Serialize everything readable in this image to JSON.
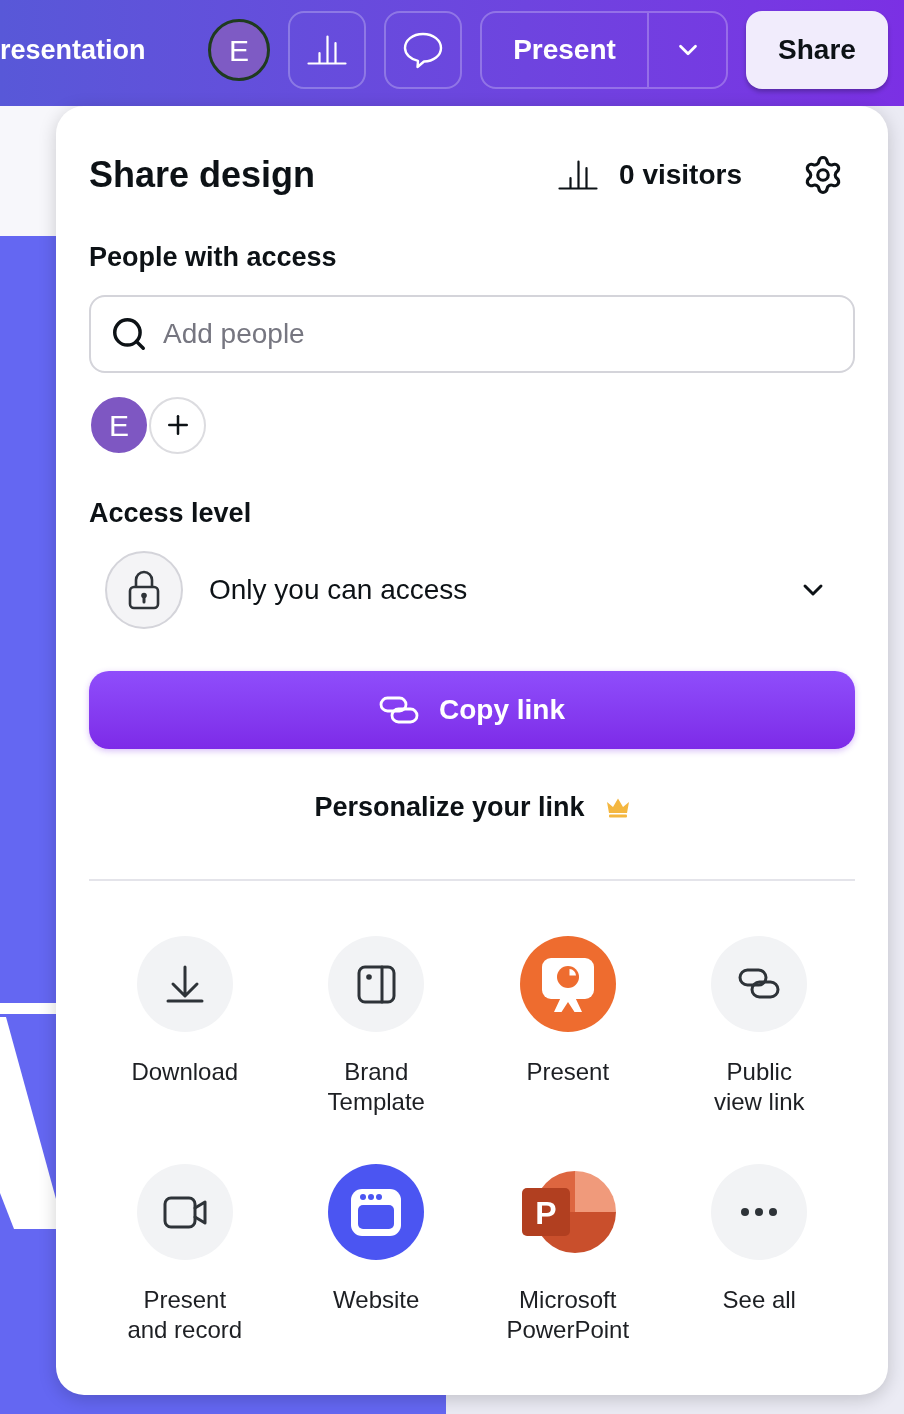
{
  "toolbar": {
    "document_title": "resentation",
    "avatar_initial": "E",
    "present_button": "Present",
    "share_button": "Share"
  },
  "share_panel": {
    "title": "Share design",
    "visitors": "0 visitors",
    "people_heading": "People with access",
    "search": {
      "placeholder": "Add people"
    },
    "people": [
      {
        "initial": "E"
      }
    ],
    "access_heading": "Access level",
    "access_level": "Only you can access",
    "copy_link_button": "Copy link",
    "personalize_link": "Personalize your link",
    "options": [
      {
        "label": "Download"
      },
      {
        "label": "Brand\nTemplate"
      },
      {
        "label": "Present"
      },
      {
        "label": "Public\nview link"
      },
      {
        "label": "Present\nand record"
      },
      {
        "label": "Website"
      },
      {
        "label": "Microsoft\nPowerPoint",
        "logo_letter": "P"
      },
      {
        "label": "See all"
      }
    ]
  }
}
